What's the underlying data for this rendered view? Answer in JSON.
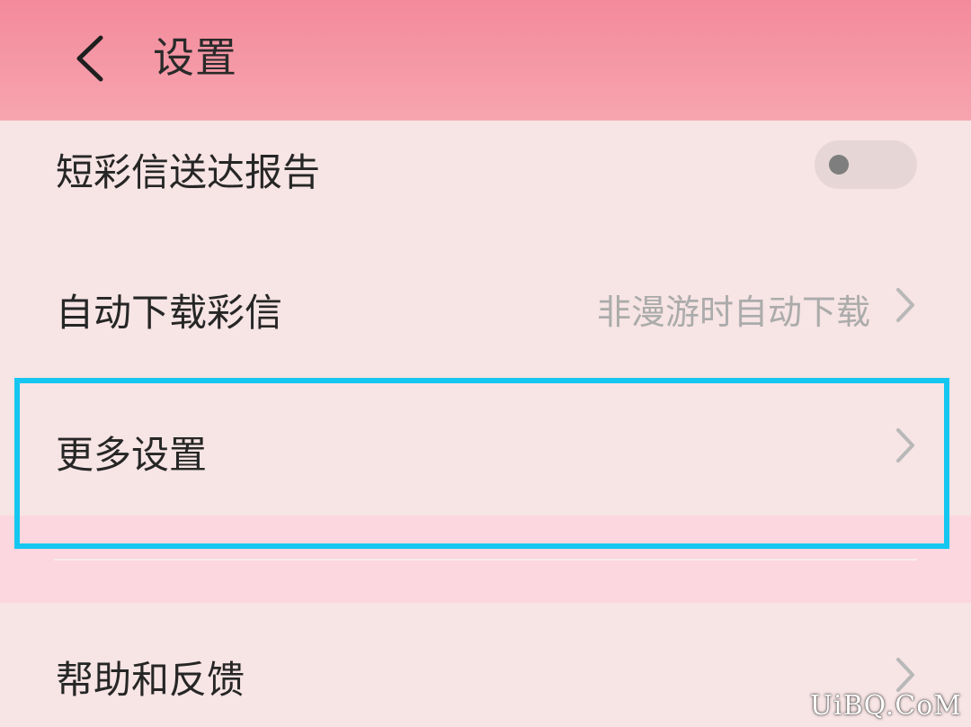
{
  "header": {
    "title": "设置",
    "back_icon": "chevron-left-icon"
  },
  "rows": {
    "delivery_report": {
      "label": "短彩信送达报告",
      "toggle_on": false
    },
    "auto_download": {
      "label": "自动下载彩信",
      "value": "非漫游时自动下载"
    },
    "more_settings": {
      "label": "更多设置"
    },
    "help_feedback": {
      "label": "帮助和反馈"
    }
  },
  "colors": {
    "header_top": "#f38a9b",
    "header_bottom": "#f7a5b0",
    "background": "#f7e4e4",
    "highlight": "#15c7f0",
    "section_gap": "#fcd7df"
  },
  "watermark": "UiBQ.CoM"
}
